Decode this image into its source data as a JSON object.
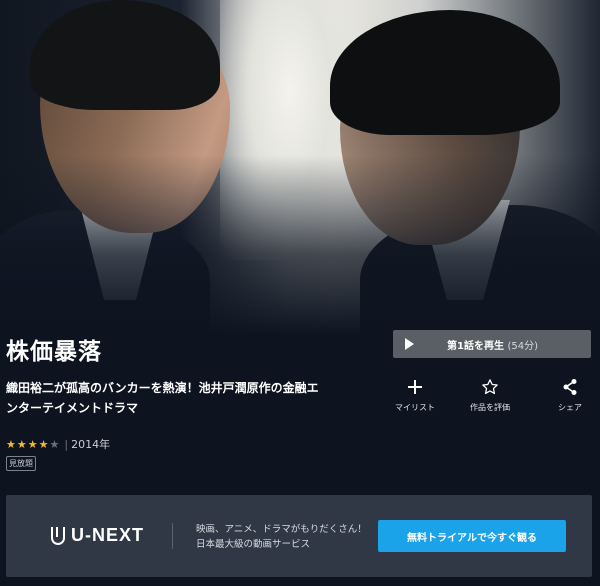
{
  "title": "株価暴落",
  "description": "織田裕二が孤高のバンカーを熱演！池井戸潤原作の金融エンターテイメントドラマ",
  "rating": {
    "stars_filled": 4,
    "stars_total": 5,
    "year": "2014年"
  },
  "badge": "見放題",
  "play": {
    "label": "第1話を再生",
    "duration": "(54分)"
  },
  "actions": [
    {
      "label": "マイリスト",
      "icon": "plus-icon"
    },
    {
      "label": "作品を評価",
      "icon": "star-outline-icon"
    },
    {
      "label": "シェア",
      "icon": "share-icon"
    }
  ],
  "promo": {
    "brand": "U-NEXT",
    "line1": "映画、アニメ、ドラマがもりだくさん！",
    "line2": "日本最大級の動画サービス",
    "cta": "無料トライアルで今すぐ観る"
  },
  "colors": {
    "background": "#0d1420",
    "star": "#f5b92a",
    "cta": "#1aa3e8",
    "play_button": "#5a5f66",
    "promo_bg": "#303745"
  }
}
